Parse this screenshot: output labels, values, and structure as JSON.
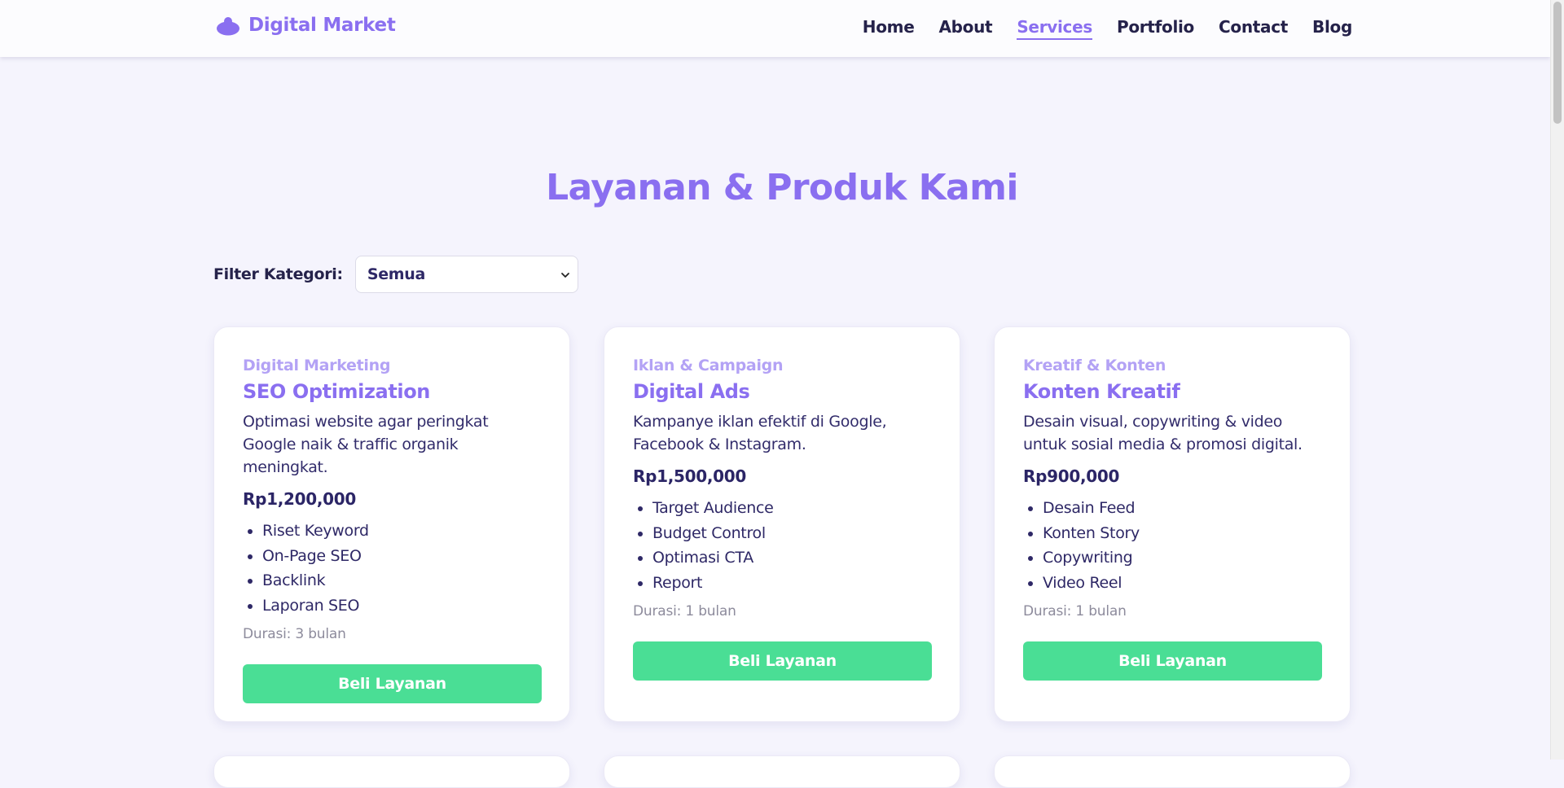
{
  "brand": {
    "name": "Digital Market",
    "icon": "blob-icon",
    "color": "#8a6ff0"
  },
  "nav": {
    "items": [
      "Home",
      "About",
      "Services",
      "Portfolio",
      "Contact",
      "Blog"
    ],
    "active": "Services"
  },
  "page": {
    "title": "Layanan & Produk Kami"
  },
  "filter": {
    "label": "Filter Kategori:",
    "selected": "Semua"
  },
  "cards": [
    {
      "category": "Digital Marketing",
      "title": "SEO Optimization",
      "desc": "Optimasi website agar peringkat Google naik & traffic organik meningkat.",
      "price": "Rp1,200,000",
      "features": [
        "Riset Keyword",
        "On-Page SEO",
        "Backlink",
        "Laporan SEO"
      ],
      "duration": "Durasi: 3 bulan",
      "button": "Beli Layanan"
    },
    {
      "category": "Iklan & Campaign",
      "title": "Digital Ads",
      "desc": "Kampanye iklan efektif di Google, Facebook & Instagram.",
      "price": "Rp1,500,000",
      "features": [
        "Target Audience",
        "Budget Control",
        "Optimasi CTA",
        "Report"
      ],
      "duration": "Durasi: 1 bulan",
      "button": "Beli Layanan"
    },
    {
      "category": "Kreatif & Konten",
      "title": "Konten Kreatif",
      "desc": "Desain visual, copywriting & video untuk sosial media & promosi digital.",
      "price": "Rp900,000",
      "features": [
        "Desain Feed",
        "Konten Story",
        "Copywriting",
        "Video Reel"
      ],
      "duration": "Durasi: 1 bulan",
      "button": "Beli Layanan"
    }
  ],
  "colors": {
    "accent": "#8a6ff0",
    "button": "#4ade95",
    "background": "#f5f4fd"
  }
}
